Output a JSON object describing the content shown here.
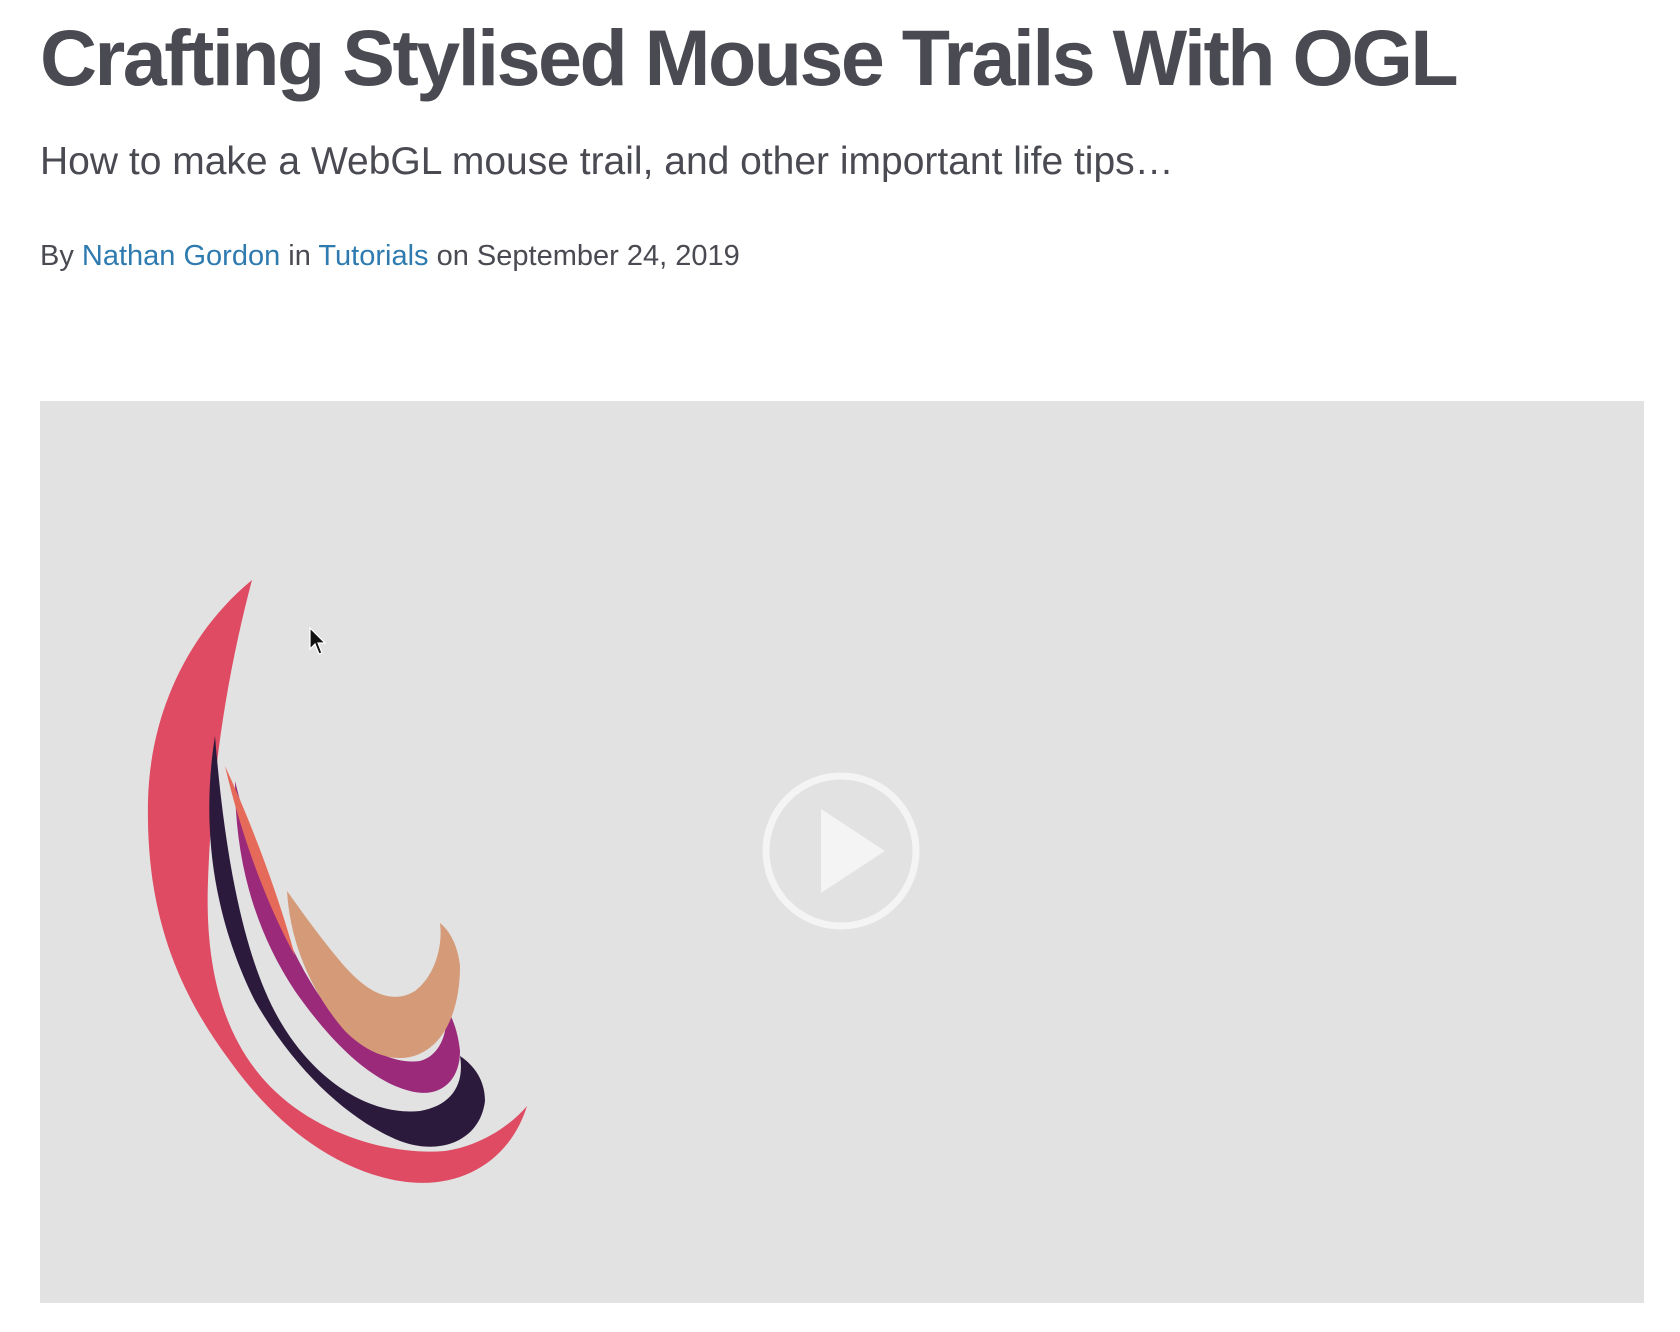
{
  "article": {
    "title": "Crafting Stylised Mouse Trails With OGL",
    "subtitle": "How to make a WebGL mouse trail, and other important life tips…",
    "byline": {
      "by": "By",
      "author": "Nathan Gordon",
      "in": "in",
      "category": "Tutorials",
      "date": "on September 24, 2019"
    }
  },
  "video": {
    "background_color": "#e2e2e2",
    "trail_colors": [
      "#df4b62",
      "#2c1a3d",
      "#9b2a7a",
      "#e66a5a",
      "#d59a78"
    ],
    "play_icon": "play-circle-icon",
    "cursor_icon": "mouse-pointer-icon"
  }
}
